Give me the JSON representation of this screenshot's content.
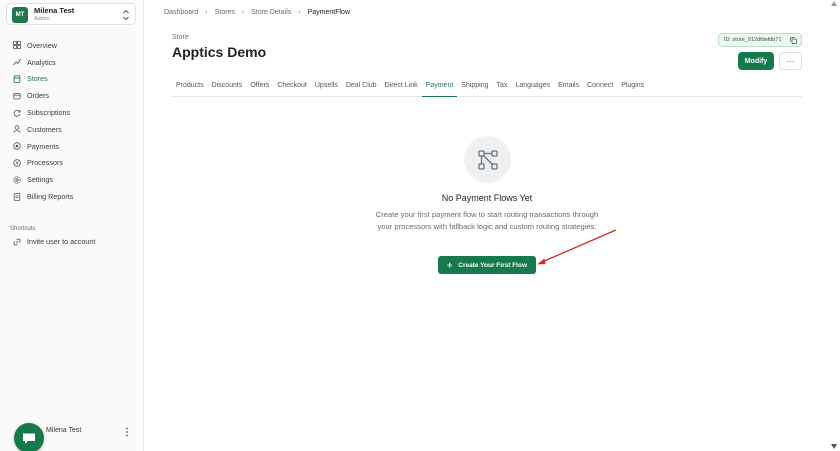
{
  "account": {
    "initials": "MT",
    "name": "Milena Test",
    "role": "Admin"
  },
  "nav": {
    "items": [
      {
        "label": "Overview",
        "icon": "grid-icon"
      },
      {
        "label": "Analytics",
        "icon": "chart-icon"
      },
      {
        "label": "Stores",
        "icon": "store-icon",
        "active": true
      },
      {
        "label": "Orders",
        "icon": "cart-icon"
      },
      {
        "label": "Subscriptions",
        "icon": "refresh-icon"
      },
      {
        "label": "Customers",
        "icon": "user-icon"
      },
      {
        "label": "Payments",
        "icon": "coin-icon"
      },
      {
        "label": "Processors",
        "icon": "processor-icon"
      },
      {
        "label": "Settings",
        "icon": "gear-icon"
      },
      {
        "label": "Billing Reports",
        "icon": "report-icon"
      }
    ]
  },
  "shortcuts": {
    "title": "Shortcuts",
    "items": [
      {
        "label": "Invite user to account",
        "icon": "link-icon"
      }
    ]
  },
  "footer_user": {
    "name": "Milena Test"
  },
  "breadcrumb": [
    "Dashboard",
    "Stores",
    "Store Details",
    "PaymentFlow"
  ],
  "store": {
    "label": "Store",
    "title": "Apptics Demo",
    "id_text": "ID: store_912dfdefdb71"
  },
  "actions": {
    "modify": "Modify",
    "more": "···"
  },
  "tabs": [
    "Products",
    "Discounts",
    "Offers",
    "Checkout",
    "Upsells",
    "Deal Club",
    "Direct Link",
    "Payment",
    "Shipping",
    "Tax",
    "Languages",
    "Emails",
    "Connect",
    "Plugins"
  ],
  "active_tab": "Payment",
  "empty_state": {
    "title": "No Payment Flows Yet",
    "description": "Create your first payment flow to start routing transactions through your processors with fallback logic and custom routing strategies.",
    "button": "Create Your First Flow",
    "button_icon": "+"
  },
  "colors": {
    "accent": "#177a4c",
    "annotation_arrow": "#d12a2a"
  }
}
